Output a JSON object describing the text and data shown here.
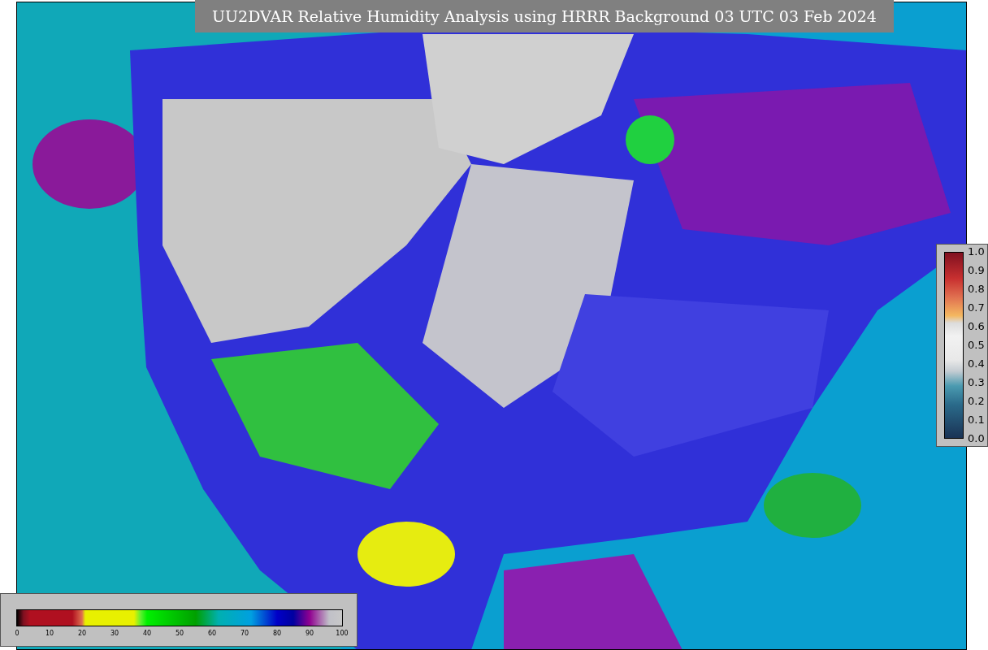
{
  "title": "UU2DVAR Relative Humidity Analysis using HRRR Background 03 UTC 03 Feb 2024",
  "station_legend": {
    "ticks": [
      "1.0",
      "0.9",
      "0.8",
      "0.7",
      "0.6",
      "0.5",
      "0.4",
      "0.3",
      "0.2",
      "0.1",
      "0.0"
    ]
  },
  "humidity_legend": {
    "ticks": [
      "0",
      "10",
      "20",
      "30",
      "40",
      "50",
      "60",
      "70",
      "80",
      "90",
      "100"
    ]
  }
}
